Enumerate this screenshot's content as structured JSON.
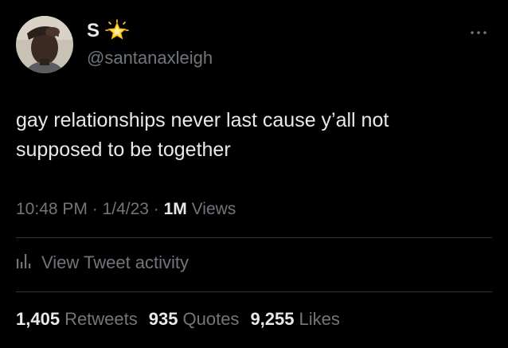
{
  "user": {
    "display_name": "S",
    "handle": "@santanaxleigh"
  },
  "icons": {
    "badge": "glowing-star-icon",
    "more": "more-dots-icon",
    "activity": "bar-chart-icon"
  },
  "tweet": {
    "line1": "gay relationships never last cause y’all not",
    "line2": "supposed to be together"
  },
  "meta": {
    "time": "10:48 PM",
    "sep1": " · ",
    "date": "1/4/23",
    "sep2": " · ",
    "views_count": "1M",
    "views_label": " Views"
  },
  "activity": {
    "label": "View Tweet activity"
  },
  "stats": {
    "retweets_count": "1,405",
    "retweets_label": "Retweets",
    "quotes_count": "935",
    "quotes_label": "Quotes",
    "likes_count": "9,255",
    "likes_label": "Likes"
  },
  "colors": {
    "background": "#000000",
    "primary_text": "#e7e9ea",
    "secondary_text": "#71767b",
    "divider": "#2f3336",
    "star": "#ffd23f"
  }
}
